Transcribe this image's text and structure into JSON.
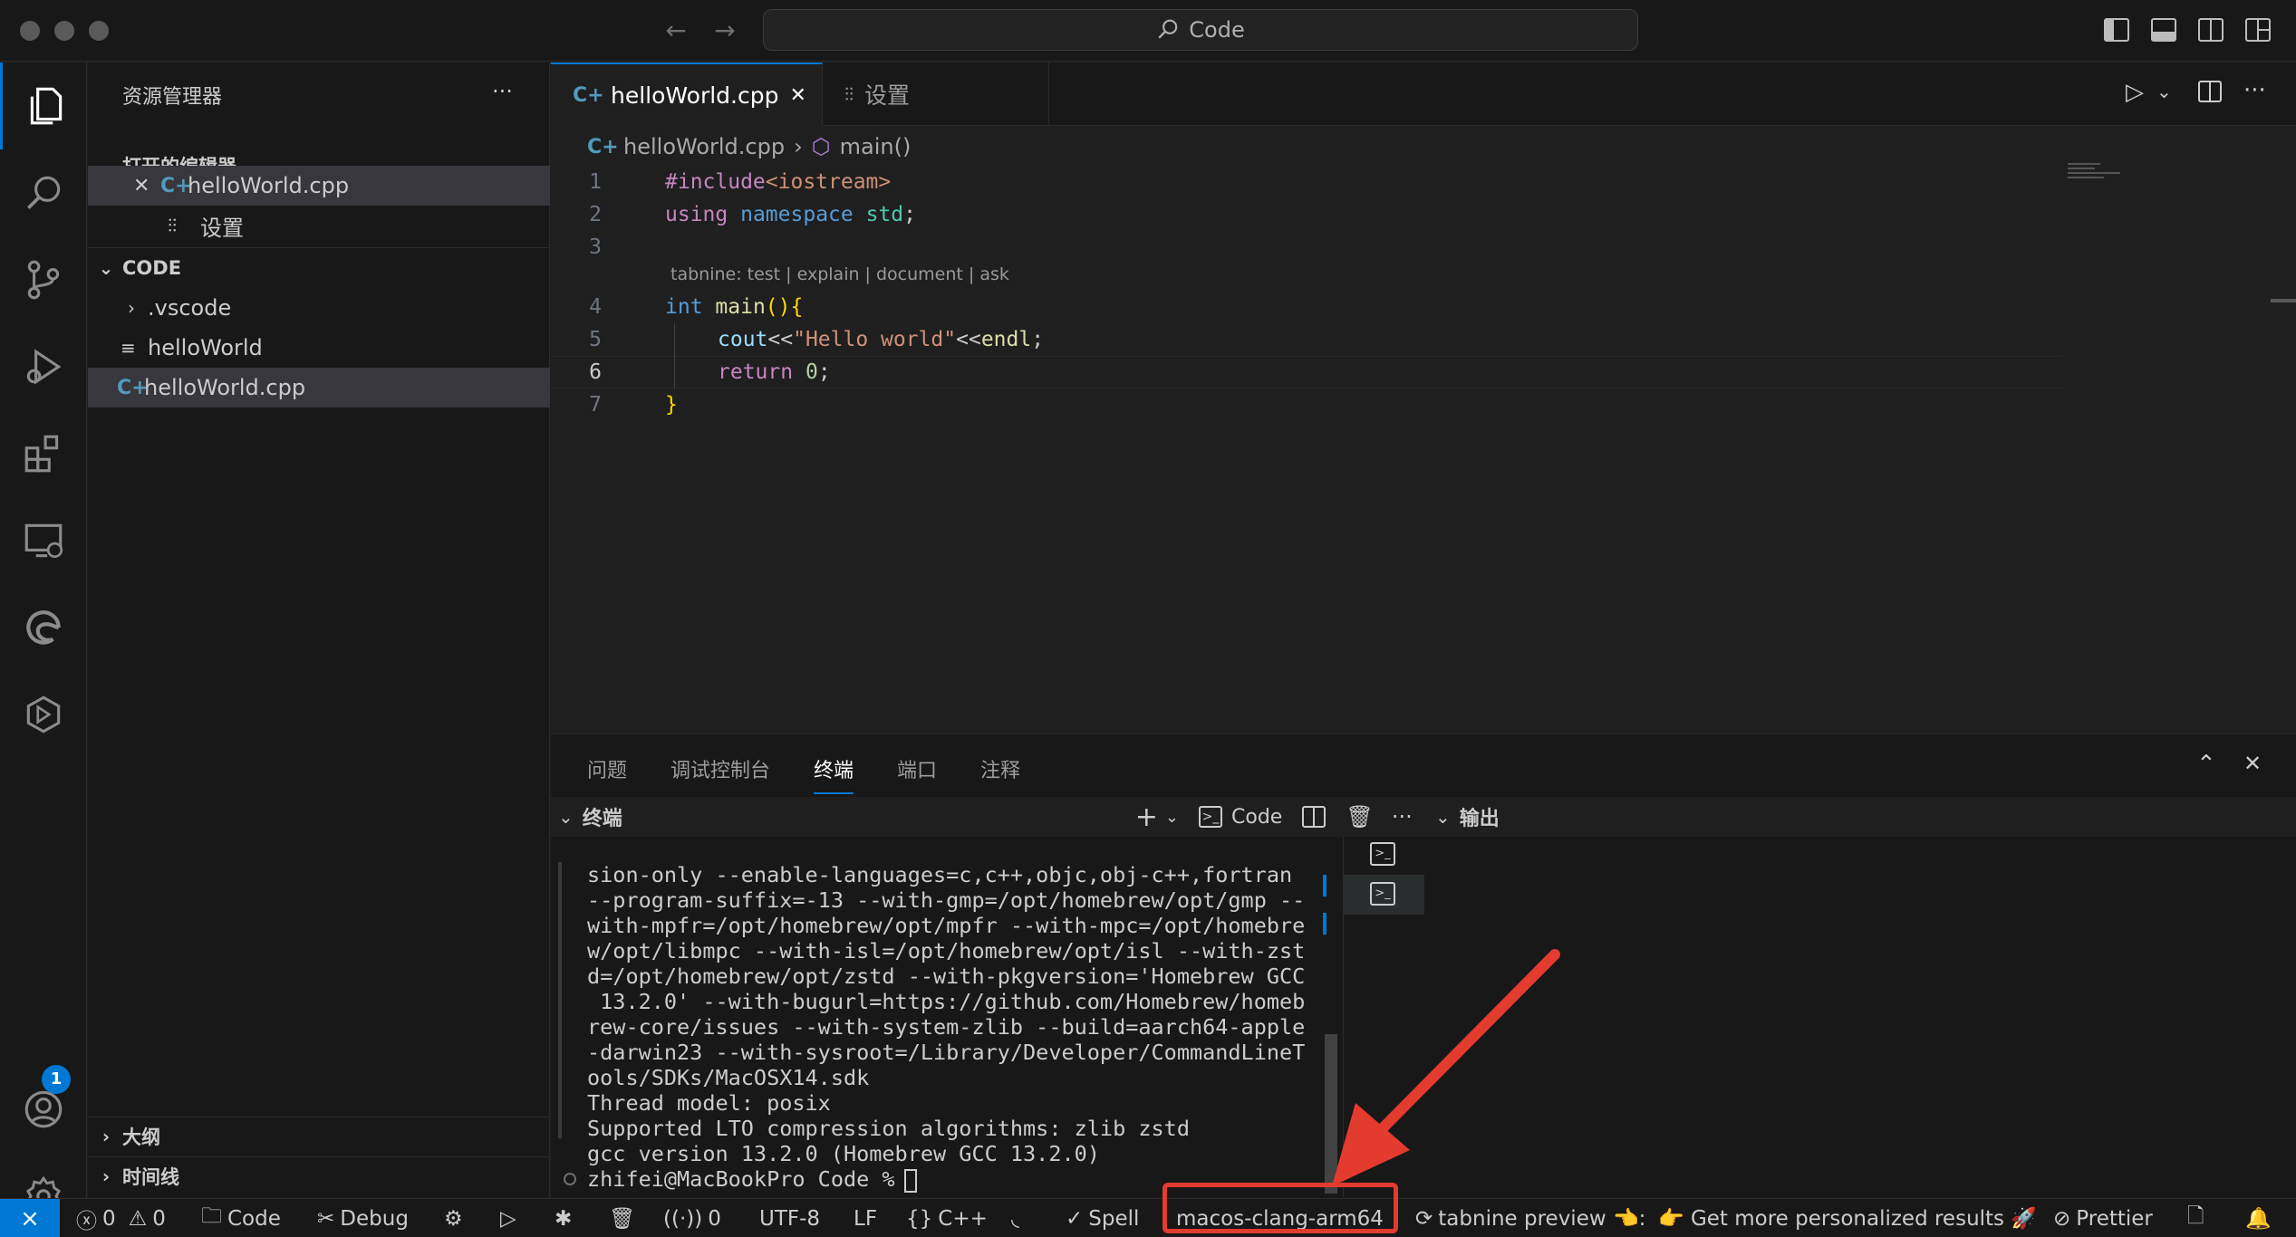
{
  "titlebar": {
    "search": "Code"
  },
  "sidebar": {
    "title": "资源管理器",
    "more": "···",
    "open_editors": {
      "label": "打开的编辑器",
      "items": [
        {
          "close": "✕",
          "icon": "cpp-file-icon",
          "label": "helloWorld.cpp"
        },
        {
          "icon": "settings-sliders-icon",
          "label": "设置"
        }
      ]
    },
    "folder": {
      "label": "CODE",
      "items": [
        {
          "label": ".vscode",
          "type": "folder"
        },
        {
          "label": "helloWorld",
          "type": "file"
        },
        {
          "label": "helloWorld.cpp",
          "type": "cpp"
        }
      ]
    },
    "outline": "大纲",
    "timeline": "时间线"
  },
  "editor": {
    "tabs": [
      {
        "label": "helloWorld.cpp",
        "close": "✕"
      },
      {
        "label": "设置"
      }
    ],
    "breadcrumb": {
      "file": "helloWorld.cpp",
      "symbol": "main()"
    },
    "codelens": "tabnine: test | explain | document | ask",
    "line_numbers": [
      "1",
      "2",
      "3",
      "4",
      "5",
      "6",
      "7"
    ]
  },
  "panel": {
    "tabs": [
      "问题",
      "调试控制台",
      "终端",
      "端口",
      "注释"
    ],
    "terminal_label": "终端",
    "terminal_name": "Code",
    "output_label": "输出",
    "terminal_lines": [
      "sion-only --enable-languages=c,c++,objc,obj-c++,fortran",
      "--program-suffix=-13 --with-gmp=/opt/homebrew/opt/gmp --",
      "with-mpfr=/opt/homebrew/opt/mpfr --with-mpc=/opt/homebre",
      "w/opt/libmpc --with-isl=/opt/homebrew/opt/isl --with-zst",
      "d=/opt/homebrew/opt/zstd --with-pkgversion='Homebrew GCC",
      " 13.2.0' --with-bugurl=https://github.com/Homebrew/homeb",
      "rew-core/issues --with-system-zlib --build=aarch64-apple",
      "-darwin23 --with-sysroot=/Library/Developer/CommandLineT",
      "ools/SDKs/MacOSX14.sdk",
      "Thread model: posix",
      "Supported LTO compression algorithms: zlib zstd",
      "gcc version 13.2.0 (Homebrew GCC 13.2.0)",
      "zhifei@MacBookPro Code % "
    ]
  },
  "statusbar": {
    "errors": "0",
    "warnings": "0",
    "folder": "Code",
    "debug": "Debug",
    "ports": "0",
    "encoding": "UTF-8",
    "eol": "LF",
    "language": "C++",
    "spell": "Spell",
    "config": "macos-clang-arm64",
    "tabnine": "tabnine preview 👈:",
    "promo": "👉 Get more personalized results 🚀",
    "prettier": "Prettier"
  },
  "colors": {
    "accent": "#0078d4",
    "highlight": "#e33b2e"
  }
}
